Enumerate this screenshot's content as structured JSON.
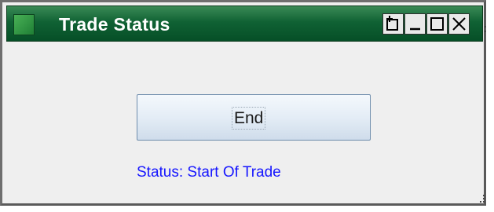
{
  "window": {
    "title": "Trade Status",
    "controls": {
      "float": "float-icon",
      "minimize": "minimize-icon",
      "maximize": "maximize-icon",
      "close": "close-icon"
    }
  },
  "main": {
    "end_button_label": "End",
    "status_text": "Status: Start Of Trade"
  },
  "colors": {
    "titlebar": "#0e5e30",
    "status_text": "#1717ff",
    "window_background": "#efefef"
  }
}
